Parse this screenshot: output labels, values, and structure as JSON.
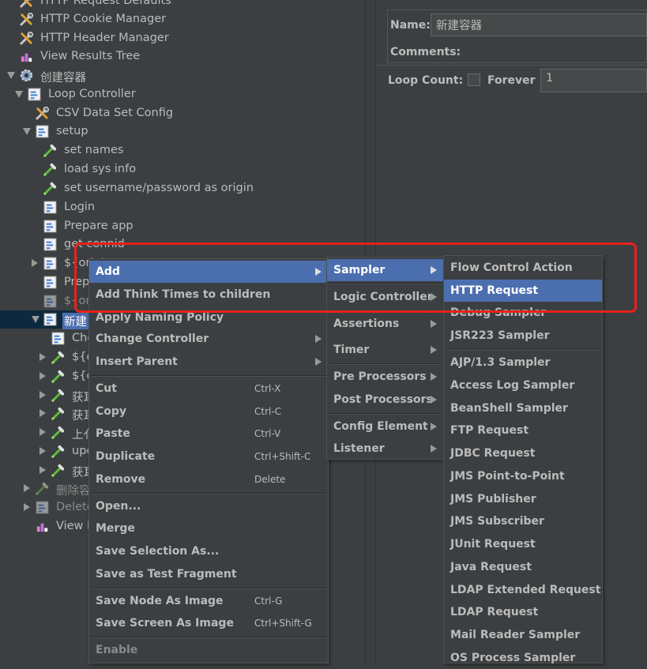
{
  "tree": {
    "items": [
      {
        "label": "HTTP Request Defaults",
        "icon": "wrench-icon"
      },
      {
        "label": "HTTP Cookie Manager",
        "icon": "wrench-icon"
      },
      {
        "label": "HTTP Header Manager",
        "icon": "wrench-icon"
      },
      {
        "label": "View Results Tree",
        "icon": "chart-icon"
      },
      {
        "label": "创建容器",
        "icon": "gear-icon"
      },
      {
        "label": "Loop Controller",
        "icon": "controller-icon"
      },
      {
        "label": "CSV Data Set Config",
        "icon": "wrench-icon"
      },
      {
        "label": "setup",
        "icon": "controller-icon"
      },
      {
        "label": "set names",
        "icon": "pipette-icon"
      },
      {
        "label": "load sys info",
        "icon": "pipette-icon"
      },
      {
        "label": "set username/password as origin",
        "icon": "pipette-icon"
      },
      {
        "label": "Login",
        "icon": "controller-icon"
      },
      {
        "label": "Prepare app",
        "icon": "controller-icon"
      },
      {
        "label": "get connid",
        "icon": "controller-icon"
      },
      {
        "label": "${origi",
        "icon": "controller-icon"
      },
      {
        "label": "Prep",
        "icon": "controller-icon"
      },
      {
        "label": "${origi",
        "icon": "controller-icon"
      },
      {
        "label": "新建",
        "icon": "controller-icon"
      },
      {
        "label": "Che",
        "icon": "controller-icon"
      },
      {
        "label": "${o",
        "icon": "pipette-icon"
      },
      {
        "label": "${o",
        "icon": "pipette-icon"
      },
      {
        "label": "获耳",
        "icon": "pipette-icon"
      },
      {
        "label": "获耳",
        "icon": "pipette-icon"
      },
      {
        "label": "上亻",
        "icon": "pipette-icon"
      },
      {
        "label": "upc",
        "icon": "pipette-icon"
      },
      {
        "label": "获耳",
        "icon": "pipette-icon"
      },
      {
        "label": "删除容",
        "icon": "pipette-icon"
      },
      {
        "label": "Delete",
        "icon": "controller-icon"
      },
      {
        "label": "View F",
        "icon": "chart-icon"
      }
    ]
  },
  "properties": {
    "name_label": "Name:",
    "name_value": "新建容器",
    "comments_label": "Comments:",
    "loop_count_label": "Loop Count:",
    "forever_label": "Forever",
    "loop_count_value": "1"
  },
  "context_menu": {
    "items": [
      {
        "label": "Add",
        "submenu": true,
        "highlighted": true
      },
      {
        "label": "Add Think Times to children"
      },
      {
        "label": "Apply Naming Policy"
      },
      {
        "label": "Change Controller",
        "submenu": true
      },
      {
        "label": "Insert Parent",
        "submenu": true
      },
      {
        "label": "Cut",
        "shortcut": "Ctrl-X"
      },
      {
        "label": "Copy",
        "shortcut": "Ctrl-C"
      },
      {
        "label": "Paste",
        "shortcut": "Ctrl-V"
      },
      {
        "label": "Duplicate",
        "shortcut": "Ctrl+Shift-C"
      },
      {
        "label": "Remove",
        "shortcut": "Delete"
      },
      {
        "label": "Open..."
      },
      {
        "label": "Merge"
      },
      {
        "label": "Save Selection As..."
      },
      {
        "label": "Save as Test Fragment"
      },
      {
        "label": "Save Node As Image",
        "shortcut": "Ctrl-G"
      },
      {
        "label": "Save Screen As Image",
        "shortcut": "Ctrl+Shift-G"
      },
      {
        "label": "Enable",
        "disabled": true
      }
    ]
  },
  "add_menu": {
    "items": [
      {
        "label": "Sampler",
        "highlighted": true
      },
      {
        "label": "Logic Controller"
      },
      {
        "label": "Assertions"
      },
      {
        "label": "Timer"
      },
      {
        "label": "Pre Processors"
      },
      {
        "label": "Post Processors"
      },
      {
        "label": "Config Element"
      },
      {
        "label": "Listener"
      }
    ]
  },
  "sampler_menu": {
    "items": [
      {
        "label": "Flow Control Action"
      },
      {
        "label": "HTTP Request",
        "highlighted": true
      },
      {
        "label": "Debug Sampler"
      },
      {
        "label": "JSR223 Sampler"
      },
      {
        "label": "AJP/1.3 Sampler"
      },
      {
        "label": "Access Log Sampler"
      },
      {
        "label": "BeanShell Sampler"
      },
      {
        "label": "FTP Request"
      },
      {
        "label": "JDBC Request"
      },
      {
        "label": "JMS Point-to-Point"
      },
      {
        "label": "JMS Publisher"
      },
      {
        "label": "JMS Subscriber"
      },
      {
        "label": "JUnit Request"
      },
      {
        "label": "Java Request"
      },
      {
        "label": "LDAP Extended Request"
      },
      {
        "label": "LDAP Request"
      },
      {
        "label": "Mail Reader Sampler"
      },
      {
        "label": "OS Process Sampler"
      }
    ]
  },
  "colors": {
    "background": "#3c3f41",
    "highlight": "#4b6eaf",
    "annotation": "#e8211b"
  }
}
